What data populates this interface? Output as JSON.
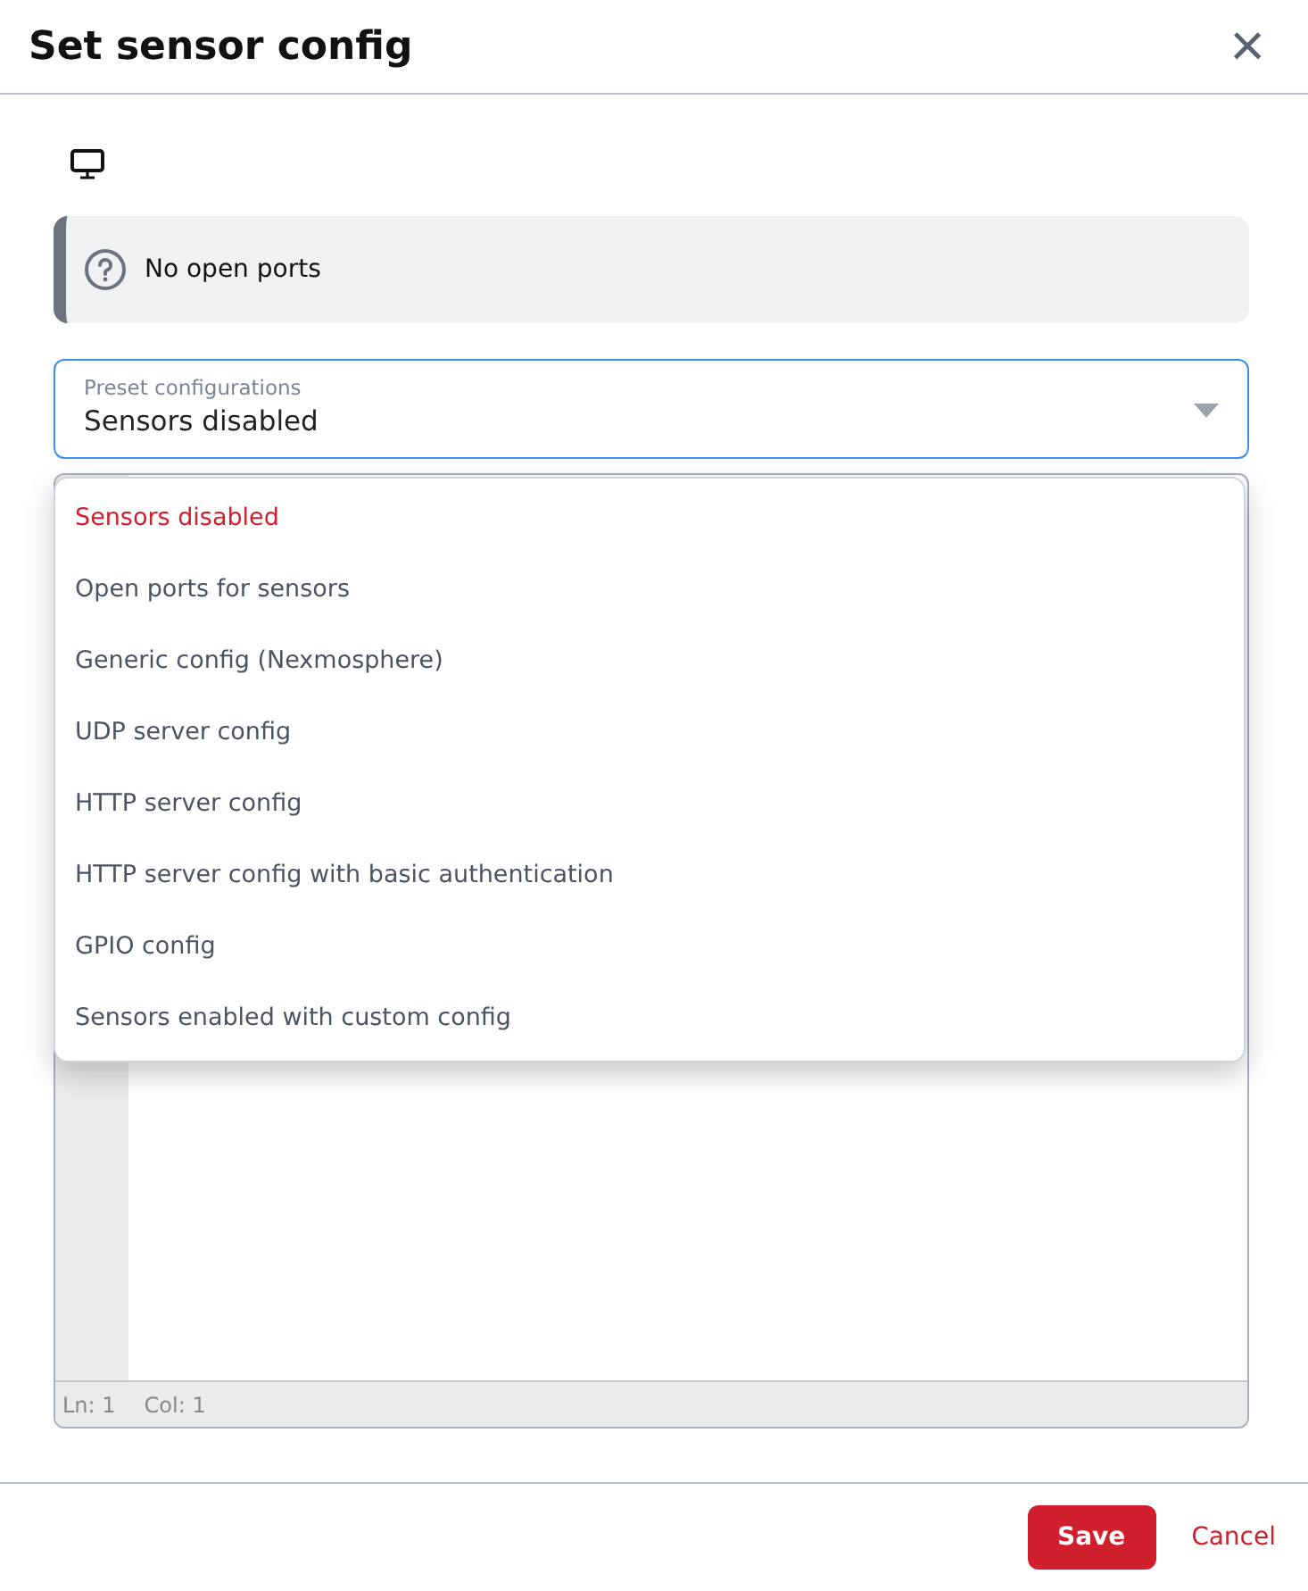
{
  "dialog": {
    "title": "Set sensor config",
    "close": "×"
  },
  "alert": {
    "text": "No open ports"
  },
  "preset_select": {
    "label": "Preset configurations",
    "value": "Sensors disabled",
    "expanded": true
  },
  "options": [
    {
      "label": "Sensors disabled",
      "selected": true
    },
    {
      "label": "Open ports for sensors",
      "selected": false
    },
    {
      "label": "Generic config (Nexmosphere)",
      "selected": false
    },
    {
      "label": "UDP server config",
      "selected": false
    },
    {
      "label": "HTTP server config",
      "selected": false
    },
    {
      "label": "HTTP server config with basic authentication",
      "selected": false
    },
    {
      "label": "GPIO config",
      "selected": false
    },
    {
      "label": "Sensors enabled with custom config",
      "selected": false
    }
  ],
  "editor": {
    "line": "Ln: 1",
    "column": "Col: 1"
  },
  "buttons": {
    "save": "Save",
    "cancel": "Cancel"
  }
}
